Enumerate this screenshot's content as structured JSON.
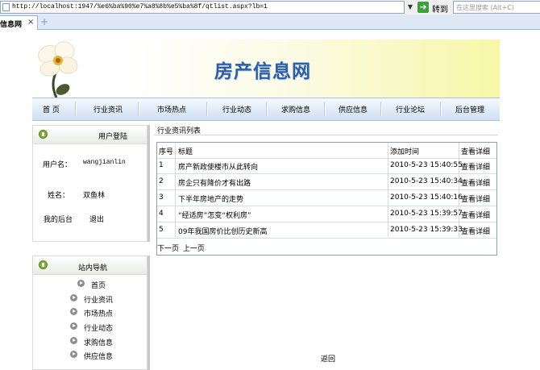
{
  "browser": {
    "url": "http://localhost:1947/%e6%ba%90%e7%a8%8b%e5%ba%8f/qtlist.aspx?lb=1",
    "go_label": "转到",
    "search_placeholder": "在这里搜索 (Alt+C)",
    "tab_label": "信息网",
    "tab_close": "×",
    "new_tab": "+"
  },
  "header": {
    "site_title": "房产信息网"
  },
  "nav": {
    "items": [
      "首 页",
      "行业资讯",
      "市场热点",
      "行业动态",
      "求购信息",
      "供应信息",
      "行业论坛",
      "后台管理"
    ]
  },
  "login_box": {
    "title": "用户登陆",
    "username_label": "用户名：",
    "username_value": "wangjianlin",
    "name_label": "姓名：",
    "name_value": "双鱼林",
    "backend_label": "我的后台",
    "logout_label": "退出"
  },
  "site_nav_box": {
    "title": "站内导航",
    "items": [
      "首页",
      "行业资讯",
      "市场热点",
      "行业动态",
      "求购信息",
      "供应信息"
    ]
  },
  "list": {
    "title": "行业资讯列表",
    "columns": [
      "序号",
      "标题",
      "添加时间",
      "查看详细"
    ],
    "rows": [
      {
        "no": "1",
        "title": "房产新政使楼市从此转向",
        "time": "2010-5-23 15:40:55",
        "action": "查看详细"
      },
      {
        "no": "2",
        "title": "房企只有降价才有出路",
        "time": "2010-5-23 15:40:34",
        "action": "查看详细"
      },
      {
        "no": "3",
        "title": "下半年房地产的走势",
        "time": "2010-5-23 15:40:16",
        "action": "查看详细"
      },
      {
        "no": "4",
        "title": "“经适房”怎变“权利房”",
        "time": "2010-5-23 15:39:57",
        "action": "查看详细"
      },
      {
        "no": "5",
        "title": "09年我国房价比创历史新高",
        "time": "2010-5-23 15:39:33",
        "action": "查看详细"
      }
    ],
    "pager": {
      "next": "下一页",
      "prev": "上一页"
    }
  },
  "footer": {
    "back_label": "返回"
  },
  "colors": {
    "nav_gradient_top": "#f5f9fe",
    "nav_gradient_bottom": "#cfdff1",
    "title_blue": "#2c5ea6",
    "icon_green": "#7faf2d"
  }
}
